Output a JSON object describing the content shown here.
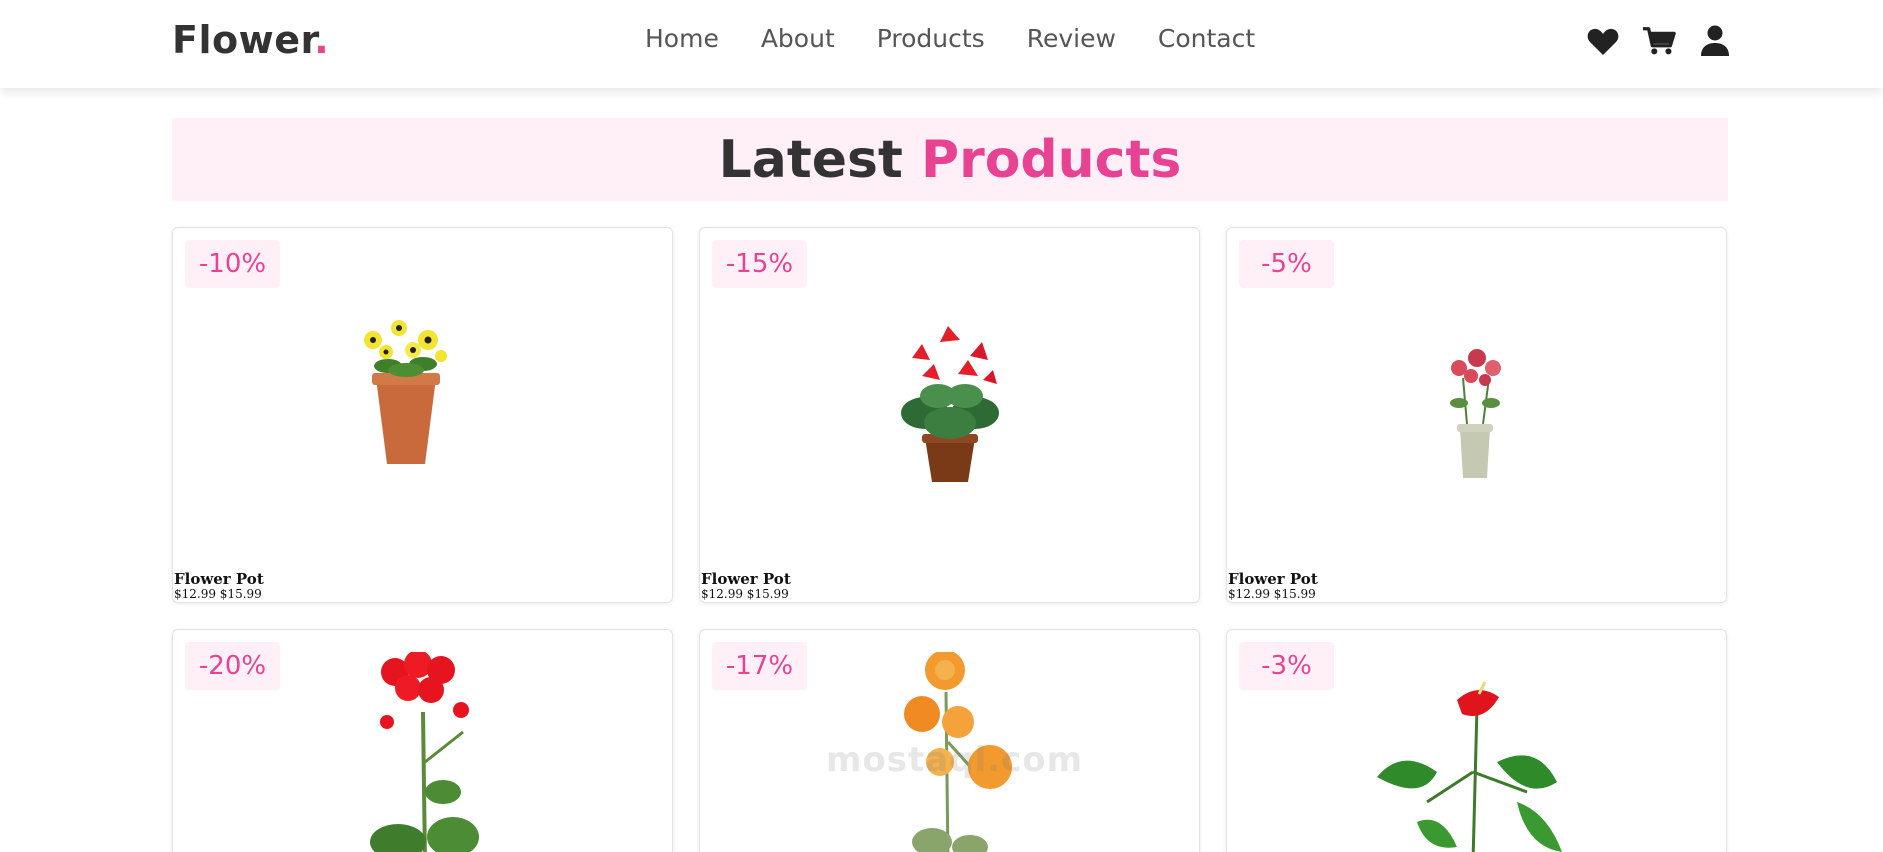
{
  "header": {
    "logo_text": "Flower",
    "logo_dot": ".",
    "nav": [
      {
        "label": "Home"
      },
      {
        "label": "About"
      },
      {
        "label": "Products"
      },
      {
        "label": "Review"
      },
      {
        "label": "Contact"
      }
    ],
    "icons": [
      "heart-icon",
      "cart-icon",
      "user-icon"
    ]
  },
  "section": {
    "title_main": "Latest",
    "title_accent": "Products"
  },
  "products": [
    {
      "discount": "-10%",
      "name": "Flower Pot",
      "price": "$12.99 $15.99"
    },
    {
      "discount": "-15%",
      "name": "Flower Pot",
      "price": "$12.99 $15.99"
    },
    {
      "discount": "-5%",
      "name": "Flower Pot",
      "price": "$12.99 $15.99"
    },
    {
      "discount": "-20%",
      "name": "",
      "price": ""
    },
    {
      "discount": "-17%",
      "name": "",
      "price": ""
    },
    {
      "discount": "-3%",
      "name": "",
      "price": ""
    }
  ],
  "watermark": "mostaql.com",
  "colors": {
    "accent": "#e84393",
    "accent_bg": "#fff0f8",
    "text": "#333333"
  }
}
